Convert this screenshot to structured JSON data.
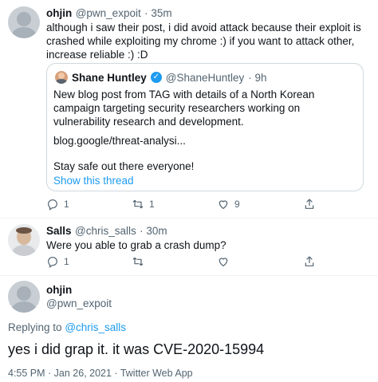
{
  "tweet1": {
    "name": "ohjin",
    "handle": "@pwn_expoit",
    "time": "· 35m",
    "text": "although i saw their post, i did avoid attack because their exploit is crashed while exploiting my chrome :) if you want to attack other, increase reliable :) :D",
    "quoted": {
      "name": "Shane Huntley",
      "handle": "@ShaneHuntley",
      "time": "· 9h",
      "text1": "New blog post from TAG with details of a North Korean campaign targeting security researchers working on vulnerability research and development.",
      "text2": "blog.google/threat-analysi...",
      "text3": "Stay safe out there everyone!",
      "show_thread": "Show this thread"
    },
    "actions": {
      "replies": "1",
      "retweets": "1",
      "likes": "9"
    }
  },
  "tweet2": {
    "name": "Salls",
    "handle": "@chris_salls",
    "time": "· 30m",
    "text": "Were you able to grab a crash dump?",
    "actions": {
      "replies": "1"
    }
  },
  "tweet3": {
    "name": "ohjin",
    "handle": "@pwn_expoit",
    "replying_prefix": "Replying to",
    "replying_to": "@chris_salls",
    "text": "yes i did grap it. it was CVE-2020-15994",
    "meta": "4:55 PM · Jan 26, 2021 · Twitter Web App"
  },
  "colors": {
    "accent": "#1d9bf0",
    "muted": "#536471",
    "text": "#0f1419"
  }
}
